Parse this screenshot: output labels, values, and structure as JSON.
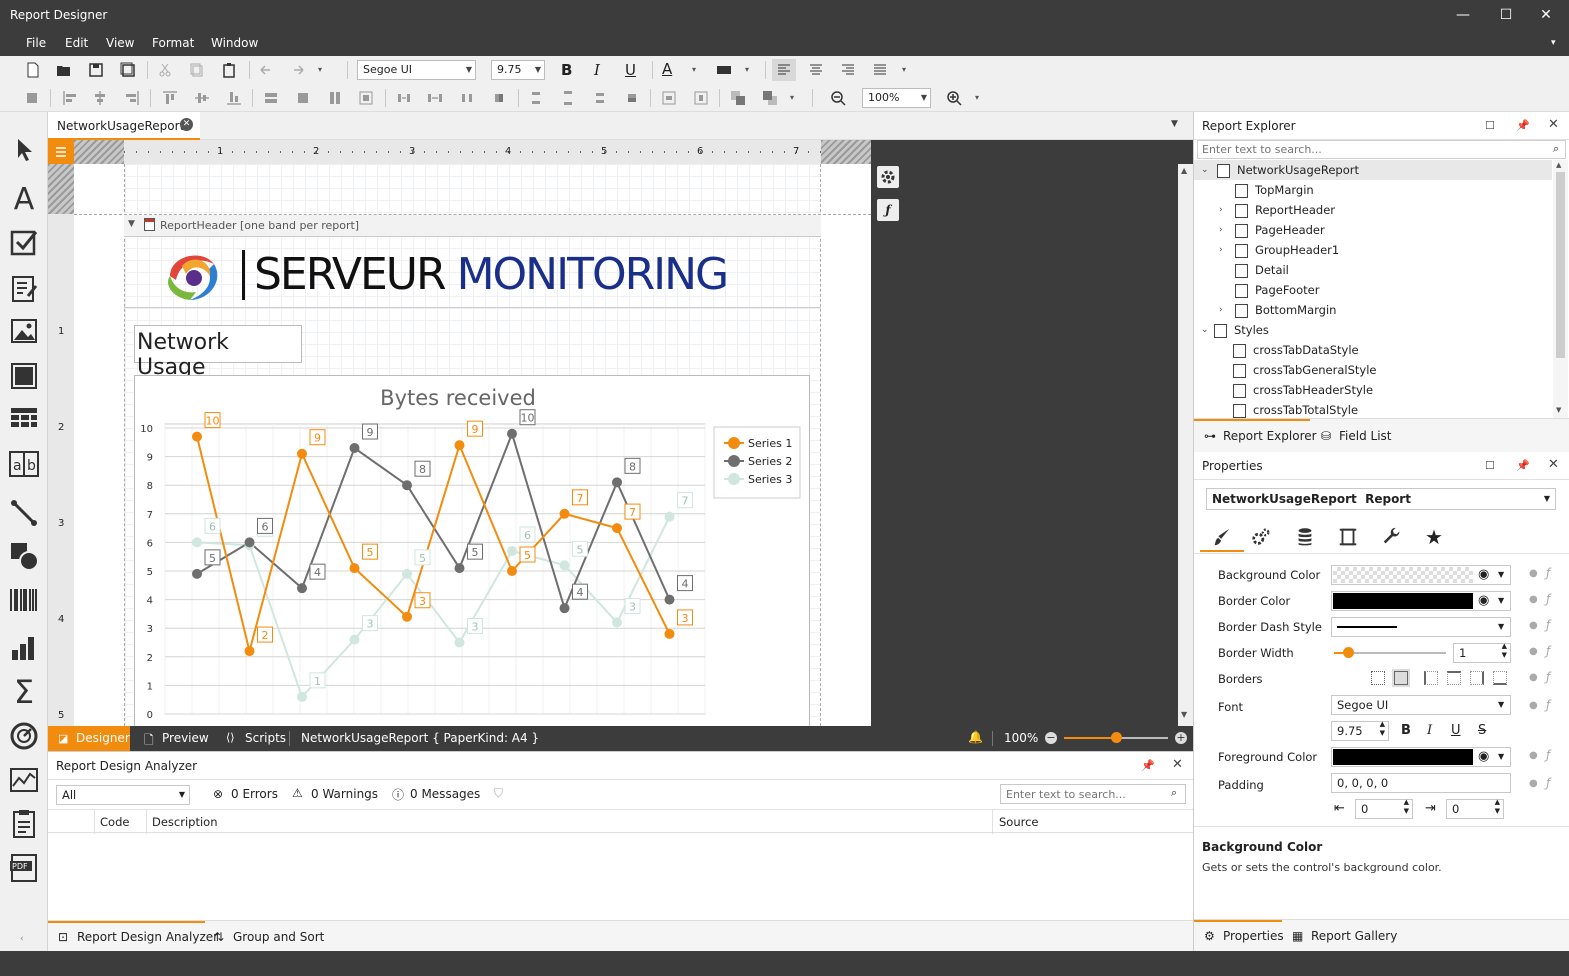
{
  "window": {
    "title": "Report Designer"
  },
  "menu": [
    "File",
    "Edit",
    "View",
    "Format",
    "Window"
  ],
  "toolbar": {
    "font_name": "Segoe UI",
    "font_size": "9.75",
    "zoom": "100%"
  },
  "doc_tab": {
    "label": "NetworkUsageReport"
  },
  "ruler": {
    "h": [
      "1",
      "2",
      "3",
      "4",
      "5",
      "6",
      "7"
    ],
    "v": [
      "1",
      "2",
      "3",
      "4",
      "5"
    ]
  },
  "report": {
    "band_label": "ReportHeader [one band per report]",
    "logo_left": "SERVEUR",
    "logo_right": "MONITORING",
    "label_text": "Network Usage"
  },
  "chart_data": {
    "type": "line",
    "title": "Bytes received",
    "ylim": [
      0,
      10
    ],
    "yticks": [
      "0",
      "1",
      "2",
      "3",
      "4",
      "5",
      "6",
      "7",
      "8",
      "9",
      "10"
    ],
    "series": [
      {
        "name": "Series 1",
        "color": "#f28c0f",
        "values": [
          10,
          2,
          9,
          5,
          3,
          9,
          5,
          7,
          7,
          3
        ],
        "ypos": [
          9.7,
          2.2,
          9.1,
          5.1,
          3.4,
          9.4,
          5.0,
          7.0,
          6.5,
          2.8
        ]
      },
      {
        "name": "Series 2",
        "color": "#6e6e6e",
        "values": [
          5,
          6,
          4,
          9,
          8,
          5,
          10,
          4,
          8,
          4
        ],
        "ypos": [
          4.9,
          6.0,
          4.4,
          9.3,
          8.0,
          5.1,
          9.8,
          3.7,
          8.1,
          4.0
        ]
      },
      {
        "name": "Series 3",
        "color": "#cfe7df",
        "values": [
          6,
          6,
          1,
          3,
          5,
          3,
          6,
          5,
          3,
          7
        ],
        "ypos": [
          6.0,
          5.9,
          0.6,
          2.6,
          4.9,
          2.5,
          5.7,
          5.2,
          3.2,
          6.9
        ]
      }
    ]
  },
  "status": {
    "designer": "Designer",
    "preview": "Preview",
    "scripts": "Scripts",
    "doc_info": "NetworkUsageReport { PaperKind: A4 }",
    "zoom": "100%"
  },
  "analyzer": {
    "title": "Report Design Analyzer",
    "filter": "All",
    "errors": "0 Errors",
    "warnings": "0 Warnings",
    "messages": "0 Messages",
    "search_placeholder": "Enter text to search...",
    "columns": [
      "Code",
      "Description",
      "Source"
    ]
  },
  "bottom_tabs": {
    "analyzer": "Report Design Analyzer",
    "group_sort": "Group and Sort",
    "properties": "Properties",
    "gallery": "Report Gallery"
  },
  "explorer": {
    "title": "Report Explorer",
    "search_placeholder": "Enter text to search...",
    "items": [
      "NetworkUsageReport",
      "TopMargin",
      "ReportHeader",
      "PageHeader",
      "GroupHeader1",
      "Detail",
      "PageFooter",
      "BottomMargin",
      "Styles",
      "crossTabDataStyle",
      "crossTabGeneralStyle",
      "crossTabHeaderStyle",
      "crossTabTotalStyle"
    ],
    "tab_explorer": "Report Explorer",
    "tab_fields": "Field List"
  },
  "properties": {
    "title": "Properties",
    "selector_name": "NetworkUsageReport",
    "selector_type": "Report",
    "labels": {
      "bg": "Background Color",
      "border_color": "Border Color",
      "border_dash": "Border Dash Style",
      "border_width": "Border Width",
      "borders": "Borders",
      "font": "Font",
      "fg": "Foreground Color",
      "padding": "Padding"
    },
    "border_width": "1",
    "font": "Segoe UI",
    "font_size": "9.75",
    "padding": "0, 0, 0, 0",
    "pad_left": "0",
    "pad_right": "0",
    "desc_title": "Background Color",
    "desc_text": "Gets or sets the control's background color."
  },
  "accent": "#f28c0f"
}
